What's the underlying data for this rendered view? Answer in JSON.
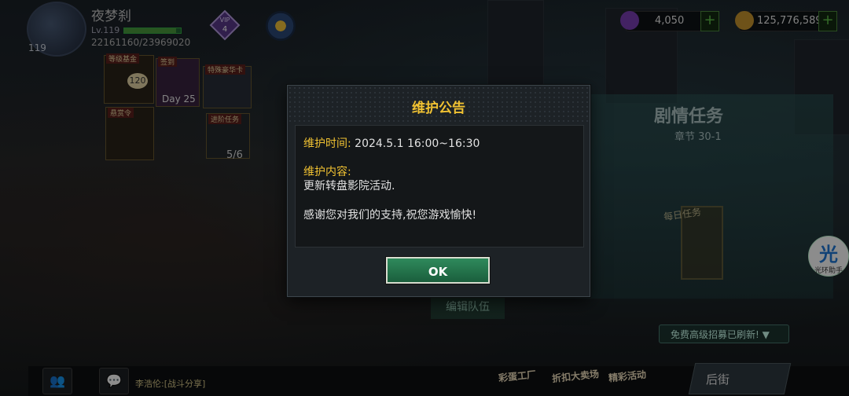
{
  "player": {
    "name": "夜梦刹",
    "level_label": "Lv.119",
    "avatar_level": "119",
    "exp": "22161160/23969020",
    "exp_progress": 0.92,
    "vip_level": "4",
    "vip_text": "VIP"
  },
  "resources": {
    "gems": "4,050",
    "gold": "125,776,589",
    "gem_color": "#7a3fb5",
    "gold_color": "#c8962e"
  },
  "left_menu": {
    "fund_label": "等级基金",
    "fund_number": "120",
    "signin_label": "签到",
    "signin_day": "Day 25",
    "specialcar_label": "特殊豪华卡",
    "bounty_label": "悬赏令",
    "progress_label": "进阶任务",
    "progress_count": "5/6"
  },
  "right_side": {
    "quest_title": "剧情任务",
    "quest_chapter": "章节 30-1",
    "daily_label": "每日任务",
    "assistant_glyph": "光",
    "assistant_label": "光环助手",
    "recruit_text": "免费高级招募已刷新!",
    "edit_team": "编辑队伍"
  },
  "bottom": {
    "chat_message": "李浩伦:[战斗分享]",
    "event1": "彩蛋工厂",
    "event2": "折扣大卖场",
    "event3": "精彩活动",
    "backstreet": "后街"
  },
  "modal": {
    "title": "维护公告",
    "time_label": "维护时间:",
    "time_value": "2024.5.1 16:00~16:30",
    "content_label": "维护内容:",
    "content_value": "更新转盘影院活动.",
    "thanks": "感谢您对我们的支持,祝您游戏愉快!",
    "ok_label": "OK",
    "title_color": "#f1c232",
    "ok_color": "#2f8a5c"
  }
}
